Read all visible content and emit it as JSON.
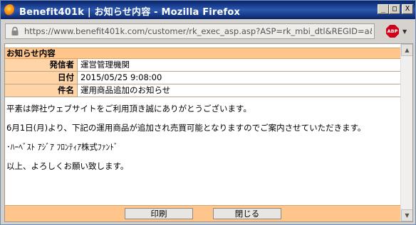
{
  "window": {
    "title": "Benefit401k | お知らせ内容 - Mozilla Firefox",
    "minimize": "_",
    "maximize": "□",
    "close": "X"
  },
  "browser": {
    "url": "https://www.benefit401k.com/customer/rk_exec_asp.asp?ASP=rk_mbi_dtl&REGID=a&INFONO=4",
    "addon_label": "ABP",
    "addon_arrow": "▼"
  },
  "notice": {
    "header": "お知らせ内容",
    "fields": [
      {
        "label": "発信者",
        "value": "運営管理機関"
      },
      {
        "label": "日付",
        "value": "2015/05/25 9:08:00"
      },
      {
        "label": "件名",
        "value": "運用商品追加のお知らせ"
      }
    ],
    "body": [
      "平素は弊社ウェブサイトをご利用頂き誠にありがとうございます。",
      "6月1日(月)より、下記の運用商品が追加され売買可能となりますのでご案内させていただきます。",
      "･ﾊｰﾍﾞｽﾄ ｱｼﾞｱ ﾌﾛﾝﾃｨｱ株式ﾌｧﾝﾄﾞ",
      "以上、よろしくお願い致します。"
    ]
  },
  "footer": {
    "print_label": "印刷",
    "close_label": "閉じる"
  },
  "scrollbar": {
    "up": "▲",
    "down": "▼"
  }
}
